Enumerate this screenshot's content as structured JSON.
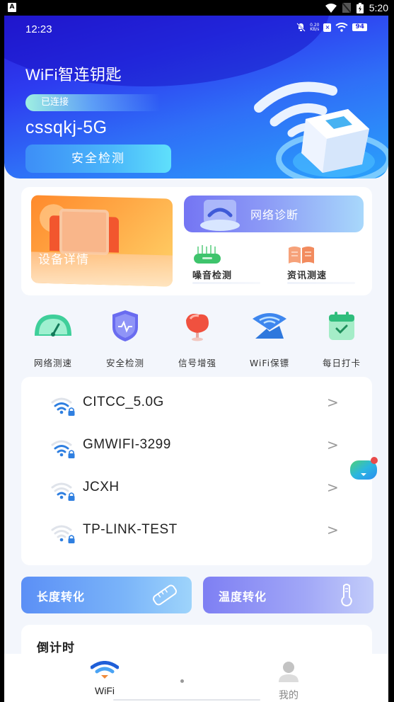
{
  "system_status": {
    "left_icon": "A",
    "time": "5:20",
    "icons": [
      "wifi-icon",
      "no-sim-icon",
      "battery-charging-icon"
    ]
  },
  "inner_status": {
    "time": "12:23",
    "speed_value": "0.20",
    "speed_unit": "KB/s",
    "battery": "94",
    "icons": [
      "mute-notification-icon",
      "sim-x-icon",
      "wifi-icon",
      "battery-icon"
    ]
  },
  "hero": {
    "app_title": "WiFi智连钥匙",
    "connection_status": "已连接",
    "ssid": "cssqkj-5G",
    "scan_button": "安全检测"
  },
  "features": {
    "device_details": "设备详情",
    "network_diagnosis": "网络诊断",
    "noise_test": "噪音检测",
    "news_speed": "资讯测速"
  },
  "quick_tools": [
    {
      "label": "网络测速",
      "icon": "speedometer-icon"
    },
    {
      "label": "安全检测",
      "icon": "shield-icon"
    },
    {
      "label": "信号增强",
      "icon": "signal-dish-icon"
    },
    {
      "label": "WiFi保镖",
      "icon": "wifi-guard-icon"
    },
    {
      "label": "每日打卡",
      "icon": "calendar-check-icon"
    }
  ],
  "wifi_list": [
    {
      "ssid": "CITCC_5.0G",
      "signal_bars": 3,
      "max_bars": 4,
      "locked": true
    },
    {
      "ssid": "GMWIFI-3299",
      "signal_bars": 3,
      "max_bars": 4,
      "locked": true
    },
    {
      "ssid": "JCXH",
      "signal_bars": 2,
      "max_bars": 4,
      "locked": true
    },
    {
      "ssid": "TP-LINK-TEST",
      "signal_bars": 1,
      "max_bars": 4,
      "locked": true
    }
  ],
  "chevron": ">",
  "converters": {
    "length": "长度转化",
    "temperature": "温度转化"
  },
  "countdown": {
    "title": "倒计时"
  },
  "bottom_nav": {
    "wifi": "WiFi",
    "me": "我的"
  },
  "colors": {
    "hero_start": "#2a1fd8",
    "hero_end": "#2aa2fb",
    "accent_blue": "#2f7df0",
    "wifi_icon_blue": "#2f7fe0",
    "nav_wifi_orange": "#f08a3a"
  }
}
